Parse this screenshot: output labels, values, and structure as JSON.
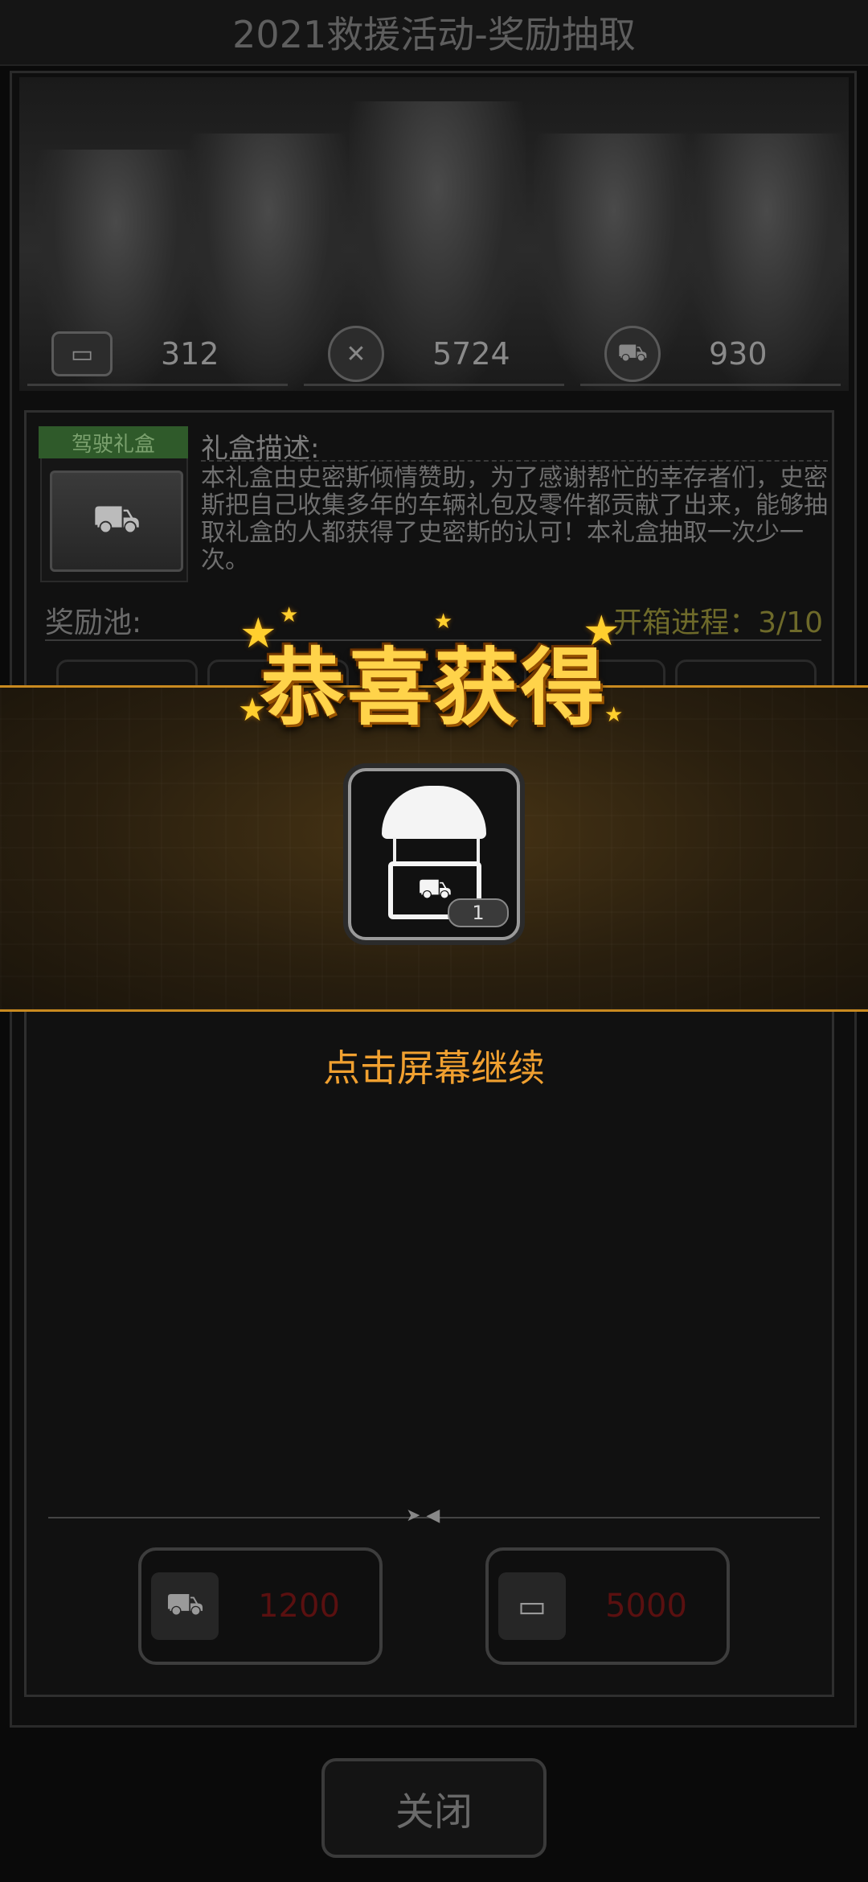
{
  "title": "2021救援活动-奖励抽取",
  "stats": [
    {
      "icon": "card-icon",
      "value": "312"
    },
    {
      "icon": "wrench-icon",
      "value": "5724"
    },
    {
      "icon": "car-icon",
      "value": "930"
    }
  ],
  "giftbox": {
    "ribbon": "驾驶礼盒",
    "desc_label": "礼盒描述:",
    "desc_text": "本礼盒由史密斯倾情赞助，为了感谢帮忙的幸存者们，史密斯把自己收集多年的车辆礼包及零件都贡献了出来，能够抽取礼盒的人都获得了史密斯的认可！本礼盒抽取一次少一次。"
  },
  "pool": {
    "label": "奖励池:",
    "progress": "开箱进程：3/10"
  },
  "popup": {
    "congrats": "恭喜获得",
    "reward_icon": "parachute-car-crate-icon",
    "reward_count": "1",
    "tap_hint": "点击屏幕继续"
  },
  "costs": [
    {
      "icon": "car-icon",
      "value": "1200"
    },
    {
      "icon": "card-icon",
      "value": "5000"
    }
  ],
  "close_label": "关闭",
  "colors": {
    "accent_gold": "#ffd34a",
    "banner_border": "#c98a20",
    "hint_orange": "#f0a030",
    "cost_red": "#5a1010"
  }
}
